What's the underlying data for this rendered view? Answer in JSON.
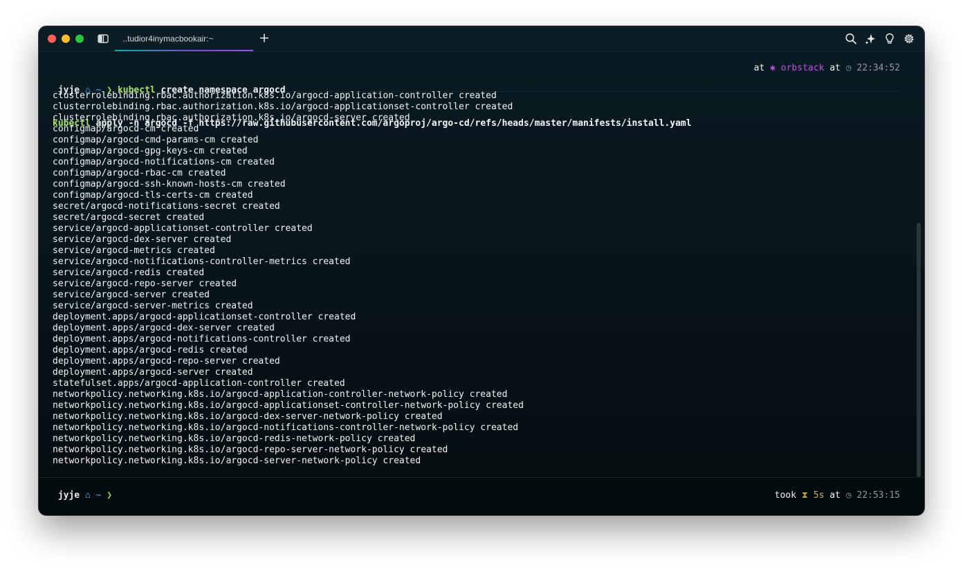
{
  "window": {
    "tab_title": "..tudior4inymacbookair:~",
    "icons": [
      "sidebar-icon",
      "plus-icon",
      "search-icon",
      "sparkle-icon",
      "lightbulb-icon",
      "gear-icon"
    ]
  },
  "colors": {
    "command": "#a8e061",
    "home": "#2f8fd8",
    "orbstack": "#c34ce6",
    "duration": "#c3ad4e",
    "close": "#ff5f57",
    "minimize": "#febc2e",
    "maximize": "#28c840"
  },
  "prompt": {
    "user": "jyje",
    "dir": "~",
    "arrow": "❯",
    "command_1_bin": "kubectl",
    "command_1_args": " create namespace argocd",
    "command_2_bin": "kubectl",
    "command_2_args": " apply -n argocd -f https://raw.githubusercontent.com/argoproj/argo-cd/refs/heads/master/manifests/install.yaml",
    "status_at_1": "at ",
    "status_context": "orbstack",
    "status_at_2": " at ",
    "status_time": "22:34:52"
  },
  "output": [
    "clusterrolebinding.rbac.authorization.k8s.io/argocd-application-controller created",
    "clusterrolebinding.rbac.authorization.k8s.io/argocd-applicationset-controller created",
    "clusterrolebinding.rbac.authorization.k8s.io/argocd-server created",
    "configmap/argocd-cm created",
    "configmap/argocd-cmd-params-cm created",
    "configmap/argocd-gpg-keys-cm created",
    "configmap/argocd-notifications-cm created",
    "configmap/argocd-rbac-cm created",
    "configmap/argocd-ssh-known-hosts-cm created",
    "configmap/argocd-tls-certs-cm created",
    "secret/argocd-notifications-secret created",
    "secret/argocd-secret created",
    "service/argocd-applicationset-controller created",
    "service/argocd-dex-server created",
    "service/argocd-metrics created",
    "service/argocd-notifications-controller-metrics created",
    "service/argocd-redis created",
    "service/argocd-repo-server created",
    "service/argocd-server created",
    "service/argocd-server-metrics created",
    "deployment.apps/argocd-applicationset-controller created",
    "deployment.apps/argocd-dex-server created",
    "deployment.apps/argocd-notifications-controller created",
    "deployment.apps/argocd-redis created",
    "deployment.apps/argocd-repo-server created",
    "deployment.apps/argocd-server created",
    "statefulset.apps/argocd-application-controller created",
    "networkpolicy.networking.k8s.io/argocd-application-controller-network-policy created",
    "networkpolicy.networking.k8s.io/argocd-applicationset-controller-network-policy created",
    "networkpolicy.networking.k8s.io/argocd-dex-server-network-policy created",
    "networkpolicy.networking.k8s.io/argocd-notifications-controller-network-policy created",
    "networkpolicy.networking.k8s.io/argocd-redis-network-policy created",
    "networkpolicy.networking.k8s.io/argocd-repo-server-network-policy created",
    "networkpolicy.networking.k8s.io/argocd-server-network-policy created"
  ],
  "footer": {
    "user": "jyje",
    "dir": "~",
    "arrow": "❯",
    "took_label": "took ",
    "took_value": "5s",
    "at_label": " at ",
    "time": "22:53:15"
  }
}
